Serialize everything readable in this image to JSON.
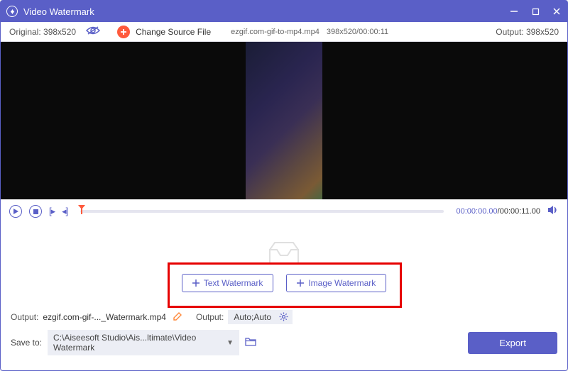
{
  "titlebar": {
    "title": "Video Watermark"
  },
  "toolbar": {
    "original_label": "Original: 398x520",
    "change_source": "Change Source File",
    "filename": "ezgif.com-gif-to-mp4.mp4",
    "filedim": "398x520/00:00:11",
    "output_label": "Output: 398x520"
  },
  "playbar": {
    "current": "00:00:00.00",
    "sep": "/",
    "duration": "00:00:11.00"
  },
  "watermark": {
    "text_btn": "Text Watermark",
    "image_btn": "Image Watermark"
  },
  "bottom": {
    "output_label": "Output:",
    "output_file": "ezgif.com-gif-..._Watermark.mp4",
    "fmt_label": "Output:",
    "fmt_value": "Auto;Auto",
    "save_label": "Save to:",
    "save_path": "C:\\Aiseesoft Studio\\Ais...ltimate\\Video Watermark",
    "export": "Export"
  }
}
